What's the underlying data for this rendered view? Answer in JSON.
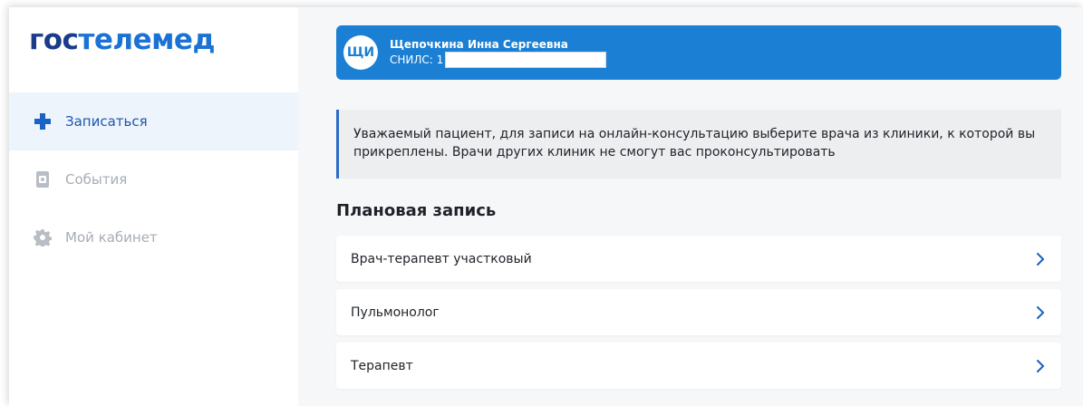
{
  "logo": {
    "part1": "гос",
    "part2": "телемед"
  },
  "sidebar": {
    "items": [
      {
        "label": "Записаться",
        "icon": "plus-icon",
        "active": true
      },
      {
        "label": "События",
        "icon": "document-icon",
        "active": false
      },
      {
        "label": "Мой кабинет",
        "icon": "gear-icon",
        "active": false
      }
    ]
  },
  "patient": {
    "initials": "ЩИ",
    "name": "Щепочкина Инна Сергеевна",
    "snils_label": "СНИЛС: 1"
  },
  "notice": {
    "text": "Уважаемый пациент, для записи на онлайн-консультацию выберите врача из клиники, к которой вы прикреплены. Врачи других клиник не смогут вас проконсультировать"
  },
  "section": {
    "title": "Плановая запись"
  },
  "specialists": [
    {
      "label": "Врач-терапевт участковый"
    },
    {
      "label": "Пульмонолог"
    },
    {
      "label": "Терапевт"
    }
  ],
  "colors": {
    "brand_dark": "#1a3a8c",
    "brand_light": "#1a72d4",
    "card_blue": "#1b7fd4",
    "active_bg": "#eef4fb"
  }
}
